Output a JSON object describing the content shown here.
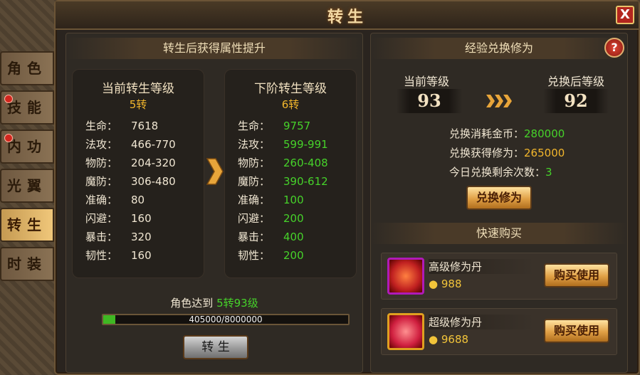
{
  "window": {
    "title": "转生",
    "close_label": "X"
  },
  "tabs": [
    {
      "label": "角色",
      "badge": false,
      "active": false
    },
    {
      "label": "技能",
      "badge": true,
      "active": false
    },
    {
      "label": "内功",
      "badge": true,
      "active": false
    },
    {
      "label": "光翼",
      "badge": false,
      "active": false
    },
    {
      "label": "转生",
      "badge": false,
      "active": true
    },
    {
      "label": "时装",
      "badge": false,
      "active": false
    }
  ],
  "left": {
    "title": "转生后获得属性提升",
    "current": {
      "header": "当前转生等级",
      "level": "5转",
      "stats": [
        {
          "k": "生命：",
          "v": "7618"
        },
        {
          "k": "法攻：",
          "v": "466-770"
        },
        {
          "k": "物防：",
          "v": "204-320"
        },
        {
          "k": "魔防：",
          "v": "306-480"
        },
        {
          "k": "准确：",
          "v": "80"
        },
        {
          "k": "闪避：",
          "v": "160"
        },
        {
          "k": "暴击：",
          "v": "320"
        },
        {
          "k": "韧性：",
          "v": "160"
        }
      ]
    },
    "next": {
      "header": "下阶转生等级",
      "level": "6转",
      "stats": [
        {
          "k": "生命：",
          "v": "9757"
        },
        {
          "k": "法攻：",
          "v": "599-991"
        },
        {
          "k": "物防：",
          "v": "260-408"
        },
        {
          "k": "魔防：",
          "v": "390-612"
        },
        {
          "k": "准确：",
          "v": "100"
        },
        {
          "k": "闪避：",
          "v": "200"
        },
        {
          "k": "暴击：",
          "v": "400"
        },
        {
          "k": "韧性：",
          "v": "200"
        }
      ]
    },
    "requirement_label": "角色达到",
    "requirement_value": "5转93级",
    "progress_text": "405000/8000000",
    "progress_fraction": 0.0506,
    "rebirth_button": "转 生"
  },
  "right": {
    "title": "经验兑换修为",
    "help_label": "?",
    "current_level_label": "当前等级",
    "current_level": "93",
    "after_level_label": "兑换后等级",
    "after_level": "92",
    "cost_label": "兑换消耗金币：",
    "cost_value": "280000",
    "gain_label": "兑换获得修为：",
    "gain_value": "265000",
    "remaining_label": "今日兑换剩余次数：",
    "remaining_value": "3",
    "exchange_button": "兑换修为",
    "quick_buy_title": "快速购买",
    "items": [
      {
        "name": "高级修为丹",
        "price": "988",
        "button": "购买使用",
        "icon": "cultivation-pill-purple-icon",
        "icon_color": "#b01ab8"
      },
      {
        "name": "超级修为丹",
        "price": "9688",
        "button": "购买使用",
        "icon": "cultivation-pill-gold-icon",
        "icon_color": "#e0a020"
      }
    ]
  },
  "colors": {
    "accent_gold": "#f2b62c",
    "stat_green": "#46d22a",
    "badge_red": "#d2261e"
  }
}
